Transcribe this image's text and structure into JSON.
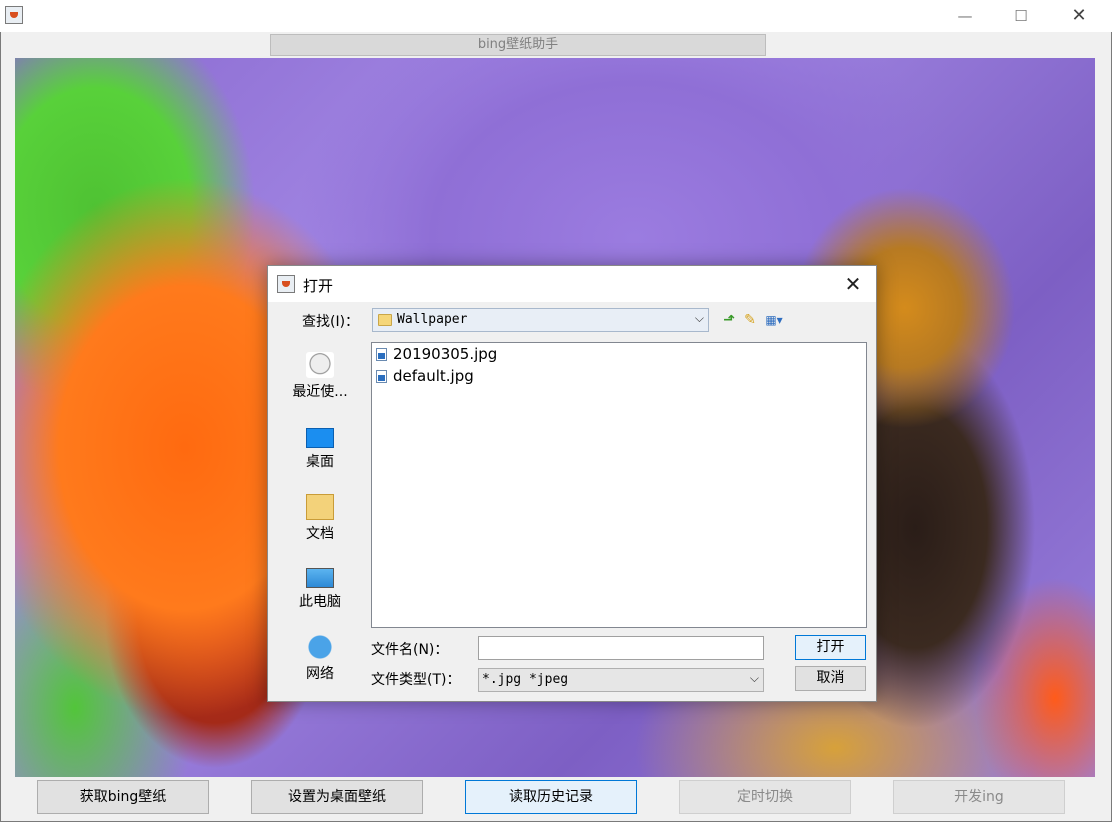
{
  "window": {
    "minimize_glyph": "—",
    "maximize_glyph": "☐",
    "close_glyph": "✕",
    "app_title": "bing壁纸助手"
  },
  "toolbar": {
    "buttons": [
      {
        "label": "获取bing壁纸",
        "state": "normal"
      },
      {
        "label": "设置为桌面壁纸",
        "state": "normal"
      },
      {
        "label": "读取历史记录",
        "state": "focused"
      },
      {
        "label": "定时切换",
        "state": "disabled"
      },
      {
        "label": "开发ing",
        "state": "disabled"
      }
    ]
  },
  "dialog": {
    "title": "打开",
    "close_glyph": "✕",
    "look_in_label": "查找(I)：",
    "look_in_value": "Wallpaper",
    "places": [
      {
        "label": "最近使...",
        "icon": "recent-items-icon"
      },
      {
        "label": "桌面",
        "icon": "desktop-icon"
      },
      {
        "label": "文档",
        "icon": "documents-icon"
      },
      {
        "label": "此电脑",
        "icon": "this-pc-icon"
      },
      {
        "label": "网络",
        "icon": "network-icon"
      }
    ],
    "files": [
      "20190305.jpg",
      "default.jpg"
    ],
    "filename_label": "文件名(N)：",
    "filename_value": "",
    "filetype_label": "文件类型(T)：",
    "filetype_value": "*.jpg *jpeg",
    "open_button": "打开",
    "cancel_button": "取消"
  }
}
